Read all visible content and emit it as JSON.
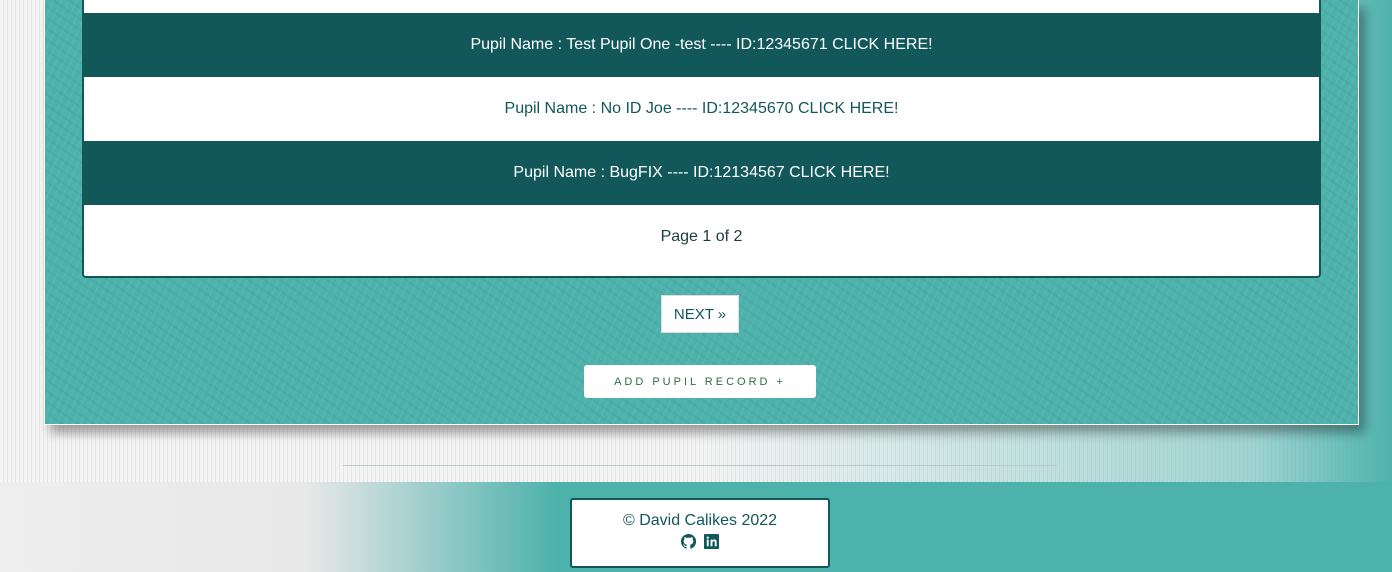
{
  "pupils": [
    {
      "label": "Pupil Name : Test Pupil One -test ---- ID:12345671 CLICK HERE!"
    },
    {
      "label": "Pupil Name : No ID Joe ---- ID:12345670 CLICK HERE!"
    },
    {
      "label": "Pupil Name : BugFIX ---- ID:12134567 CLICK HERE!"
    }
  ],
  "pagination": {
    "status": "Page 1 of 2",
    "next_label": "NEXT »"
  },
  "add_button": "ADD PUPIL RECORD +",
  "footer": {
    "copyright": "© David Calikes 2022",
    "icons": [
      "github-icon",
      "linkedin-icon"
    ]
  },
  "colors": {
    "primary": "#12585a",
    "background": "#4db1ac"
  }
}
